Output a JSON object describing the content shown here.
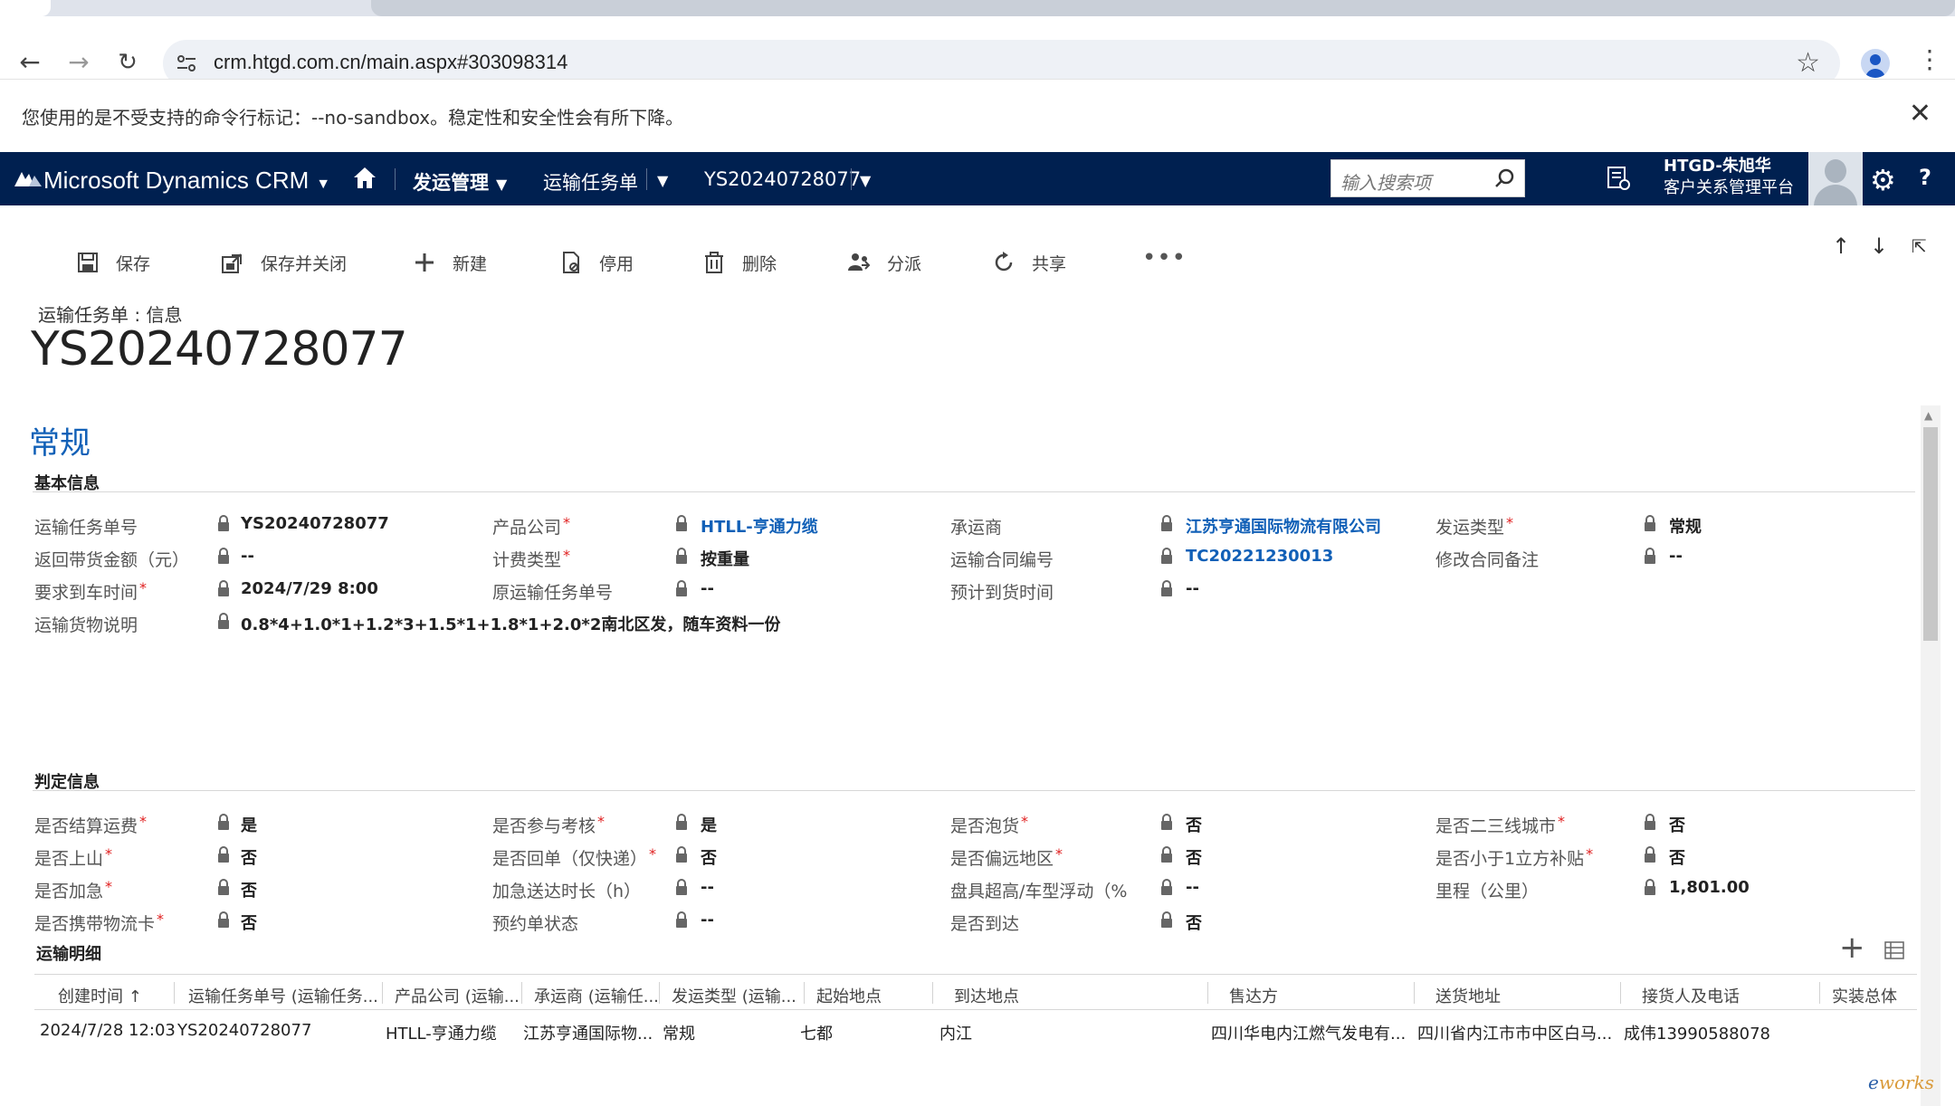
{
  "browser": {
    "url": "crm.htgd.com.cn/main.aspx#303098314",
    "infobar_message": "您使用的是不受支持的命令行标记：--no-sandbox。稳定性和安全性会有所下降。"
  },
  "crm_nav": {
    "brand": "Microsoft Dynamics CRM",
    "area": "发运管理",
    "entity": "运输任务单",
    "record": "YS20240728077",
    "search_placeholder": "输入搜索项",
    "user_name": "HTGD-朱旭华",
    "org_name": "客户关系管理平台"
  },
  "commands": {
    "save": "保存",
    "save_close": "保存并关闭",
    "new": "新建",
    "deactivate": "停用",
    "delete": "删除",
    "assign": "分派",
    "share": "共享",
    "more": "•••"
  },
  "header": {
    "entity_label": "运输任务单 : 信息",
    "title": "YS20240728077",
    "tab": "常规"
  },
  "basic_section": {
    "title": "基本信息",
    "fields": [
      {
        "label": "运输任务单号",
        "value": "YS20240728077",
        "required": false,
        "link": false
      },
      {
        "label": "产品公司",
        "value": "HTLL-亨通力缆",
        "required": true,
        "link": true
      },
      {
        "label": "承运商",
        "value": "江苏亨通国际物流有限公司",
        "required": false,
        "link": true
      },
      {
        "label": "发运类型",
        "value": "常规",
        "required": true,
        "link": false
      },
      {
        "label": "返回带货金额（元）",
        "value": "--",
        "required": false,
        "link": false
      },
      {
        "label": "计费类型",
        "value": "按重量",
        "required": true,
        "link": false
      },
      {
        "label": "运输合同编号",
        "value": "TC20221230013",
        "required": false,
        "link": true
      },
      {
        "label": "修改合同备注",
        "value": "--",
        "required": false,
        "link": false
      },
      {
        "label": "要求到车时间",
        "value": "2024/7/29   8:00",
        "required": true,
        "link": false
      },
      {
        "label": "原运输任务单号",
        "value": "--",
        "required": false,
        "link": false
      },
      {
        "label": "预计到货时间",
        "value": "--",
        "required": false,
        "link": false
      },
      {
        "label": "运输货物说明",
        "value": "0.8*4+1.0*1+1.2*3+1.5*1+1.8*1+2.0*2南北区发，随车资料一份",
        "required": false,
        "link": false
      }
    ]
  },
  "judge_section": {
    "title": "判定信息",
    "fields": [
      {
        "label": "是否结算运费",
        "value": "是",
        "required": true
      },
      {
        "label": "是否参与考核",
        "value": "是",
        "required": true
      },
      {
        "label": "是否泡货",
        "value": "否",
        "required": true
      },
      {
        "label": "是否二三线城市",
        "value": "否",
        "required": true
      },
      {
        "label": "是否上山",
        "value": "否",
        "required": true
      },
      {
        "label": "是否回单（仅快递）",
        "value": "否",
        "required": true
      },
      {
        "label": "是否偏远地区",
        "value": "否",
        "required": true
      },
      {
        "label": "是否小于1立方补贴",
        "value": "否",
        "required": true
      },
      {
        "label": "是否加急",
        "value": "否",
        "required": true
      },
      {
        "label": "加急送达时长（h）",
        "value": "--",
        "required": false
      },
      {
        "label": "盘具超高/车型浮动（%",
        "value": "--",
        "required": false
      },
      {
        "label": "里程（公里）",
        "value": "1,801.00",
        "required": false
      },
      {
        "label": "是否携带物流卡",
        "value": "否",
        "required": true
      },
      {
        "label": "预约单状态",
        "value": "--",
        "required": false
      },
      {
        "label": "是否到达",
        "value": "否",
        "required": false
      }
    ]
  },
  "grid": {
    "title": "运输明细",
    "columns": [
      "创建时间 ↑",
      "运输任务单号 (运输任务...",
      "产品公司 (运输...",
      "承运商 (运输任...",
      "发运类型 (运输...",
      "起始地点",
      "到达地点",
      "售达方",
      "送货地址",
      "接货人及电话",
      "实装总体"
    ],
    "rows": [
      [
        "2024/7/28 12:03",
        "YS20240728077",
        "HTLL-亨通力缆",
        "江苏亨通国际物...",
        "常规",
        "七都",
        "内江",
        "四川华电内江燃气发电有...",
        "四川省内江市市中区白马...",
        "成伟13990588078",
        ""
      ]
    ]
  },
  "watermark": {
    "prefix": "e",
    "text": "works"
  },
  "colors": {
    "nav_bg": "#002050",
    "link": "#1160b7",
    "required": "#e02020"
  },
  "icons": [
    "back-icon",
    "forward-icon",
    "reload-icon",
    "site-info-icon",
    "star-icon",
    "profile-icon",
    "kebab-icon",
    "close-icon",
    "dynamics-logo-icon",
    "home-icon",
    "search-icon",
    "recent-icon",
    "gear-icon",
    "help-icon",
    "save-icon",
    "save-close-icon",
    "plus-icon",
    "deactivate-icon",
    "trash-icon",
    "assign-icon",
    "share-icon",
    "lock-icon"
  ]
}
